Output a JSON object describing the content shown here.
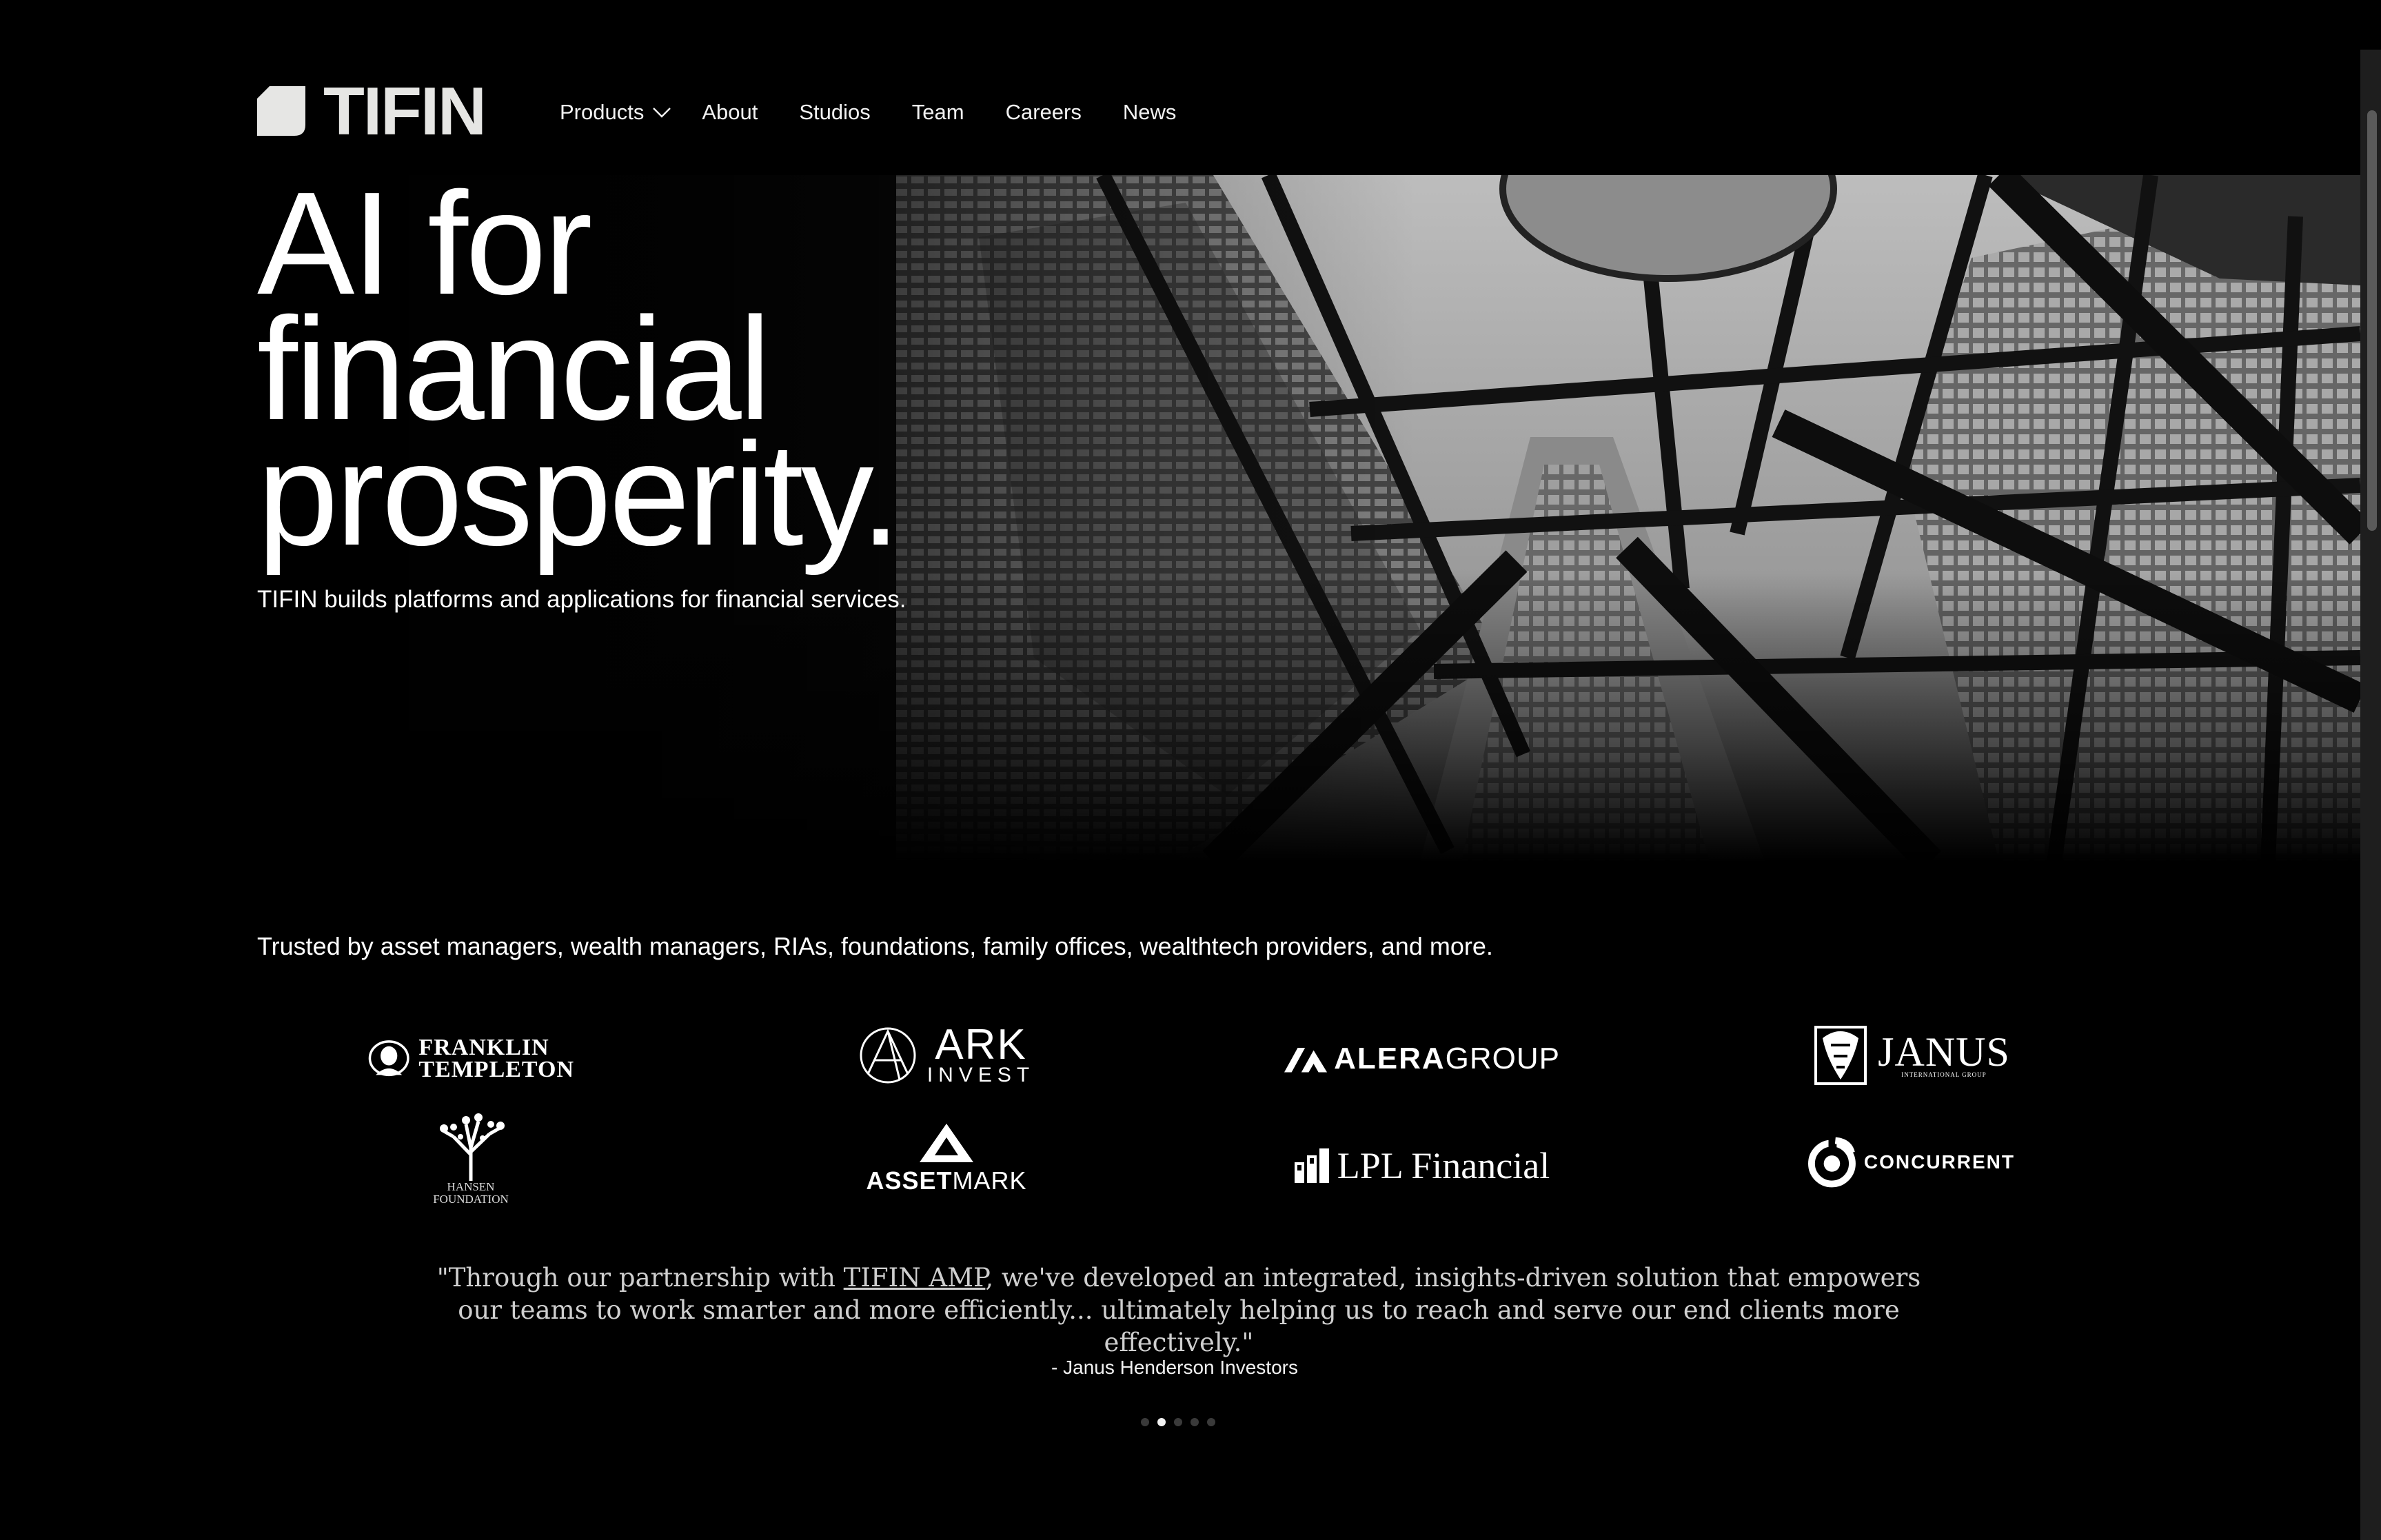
{
  "header": {
    "brand": "TIFIN",
    "nav": [
      {
        "label": "Products",
        "has_dropdown": true
      },
      {
        "label": "About"
      },
      {
        "label": "Studios"
      },
      {
        "label": "Team"
      },
      {
        "label": "Careers"
      },
      {
        "label": "News"
      }
    ]
  },
  "hero": {
    "headline_lines": [
      "AI for",
      "financial",
      "prosperity."
    ],
    "subtitle": "TIFIN builds platforms and applications for financial services."
  },
  "trusted": {
    "text": "Trusted by asset managers, wealth managers, RIAs, foundations, family offices, wealthtech providers, and more.",
    "logos": {
      "franklin": [
        "FRANKLIN",
        "TEMPLETON"
      ],
      "ark": [
        "ARK",
        "INVEST"
      ],
      "alera": [
        "ALERA",
        "GROUP"
      ],
      "janus": [
        "JANUS",
        "INTERNATIONAL GROUP"
      ],
      "hansen": [
        "HANSEN",
        "FOUNDATION"
      ],
      "assetmark": [
        "ASSET",
        "MARK"
      ],
      "lpl": "LPL Financial",
      "concurrent": "CONCURRENT"
    }
  },
  "testimonial": {
    "quote_start": "\"Through our partnership with ",
    "quote_link": "TIFIN AMP",
    "quote_end": ", we've developed an integrated, insights-driven solution that empowers our teams to work smarter and more efficiently... ultimately helping us to reach and serve our end clients more effectively.\"",
    "attribution": "- Janus Henderson Investors",
    "slide_count": 5,
    "active_slide": 2
  },
  "colors": {
    "background": "#000000",
    "text": "#ffffff",
    "quote_text": "#cfcfcf",
    "logo_mark": "#e6e6e4"
  }
}
